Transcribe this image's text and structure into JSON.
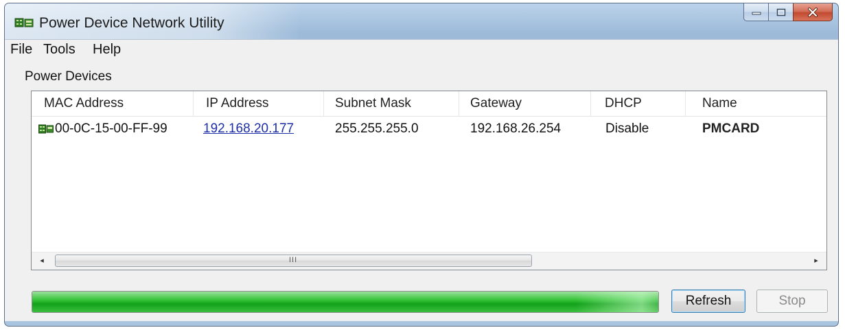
{
  "window": {
    "title": "Power Device Network Utility",
    "icon": "network-device-icon"
  },
  "caption_buttons": {
    "minimize": "minimize-icon",
    "maximize": "maximize-icon",
    "close": "close-icon"
  },
  "menu": {
    "items": [
      "File",
      "Tools",
      "Help"
    ]
  },
  "group": {
    "label": "Power Devices"
  },
  "table": {
    "columns": [
      "MAC Address",
      "IP Address",
      "Subnet Mask",
      "Gateway",
      "DHCP",
      "Name"
    ],
    "rows": [
      {
        "mac": "00-0C-15-00-FF-99",
        "ip": "192.168.20.177",
        "subnet": "255.255.255.0",
        "gateway": "192.168.26.254",
        "dhcp": "Disable",
        "name": "PMCARD"
      }
    ],
    "scroll_left": "◂",
    "scroll_right": "▸",
    "thumb_grip": "III"
  },
  "progress": {
    "fraction": 1.0,
    "color": "#22b02a"
  },
  "buttons": {
    "refresh": "Refresh",
    "stop": "Stop"
  }
}
